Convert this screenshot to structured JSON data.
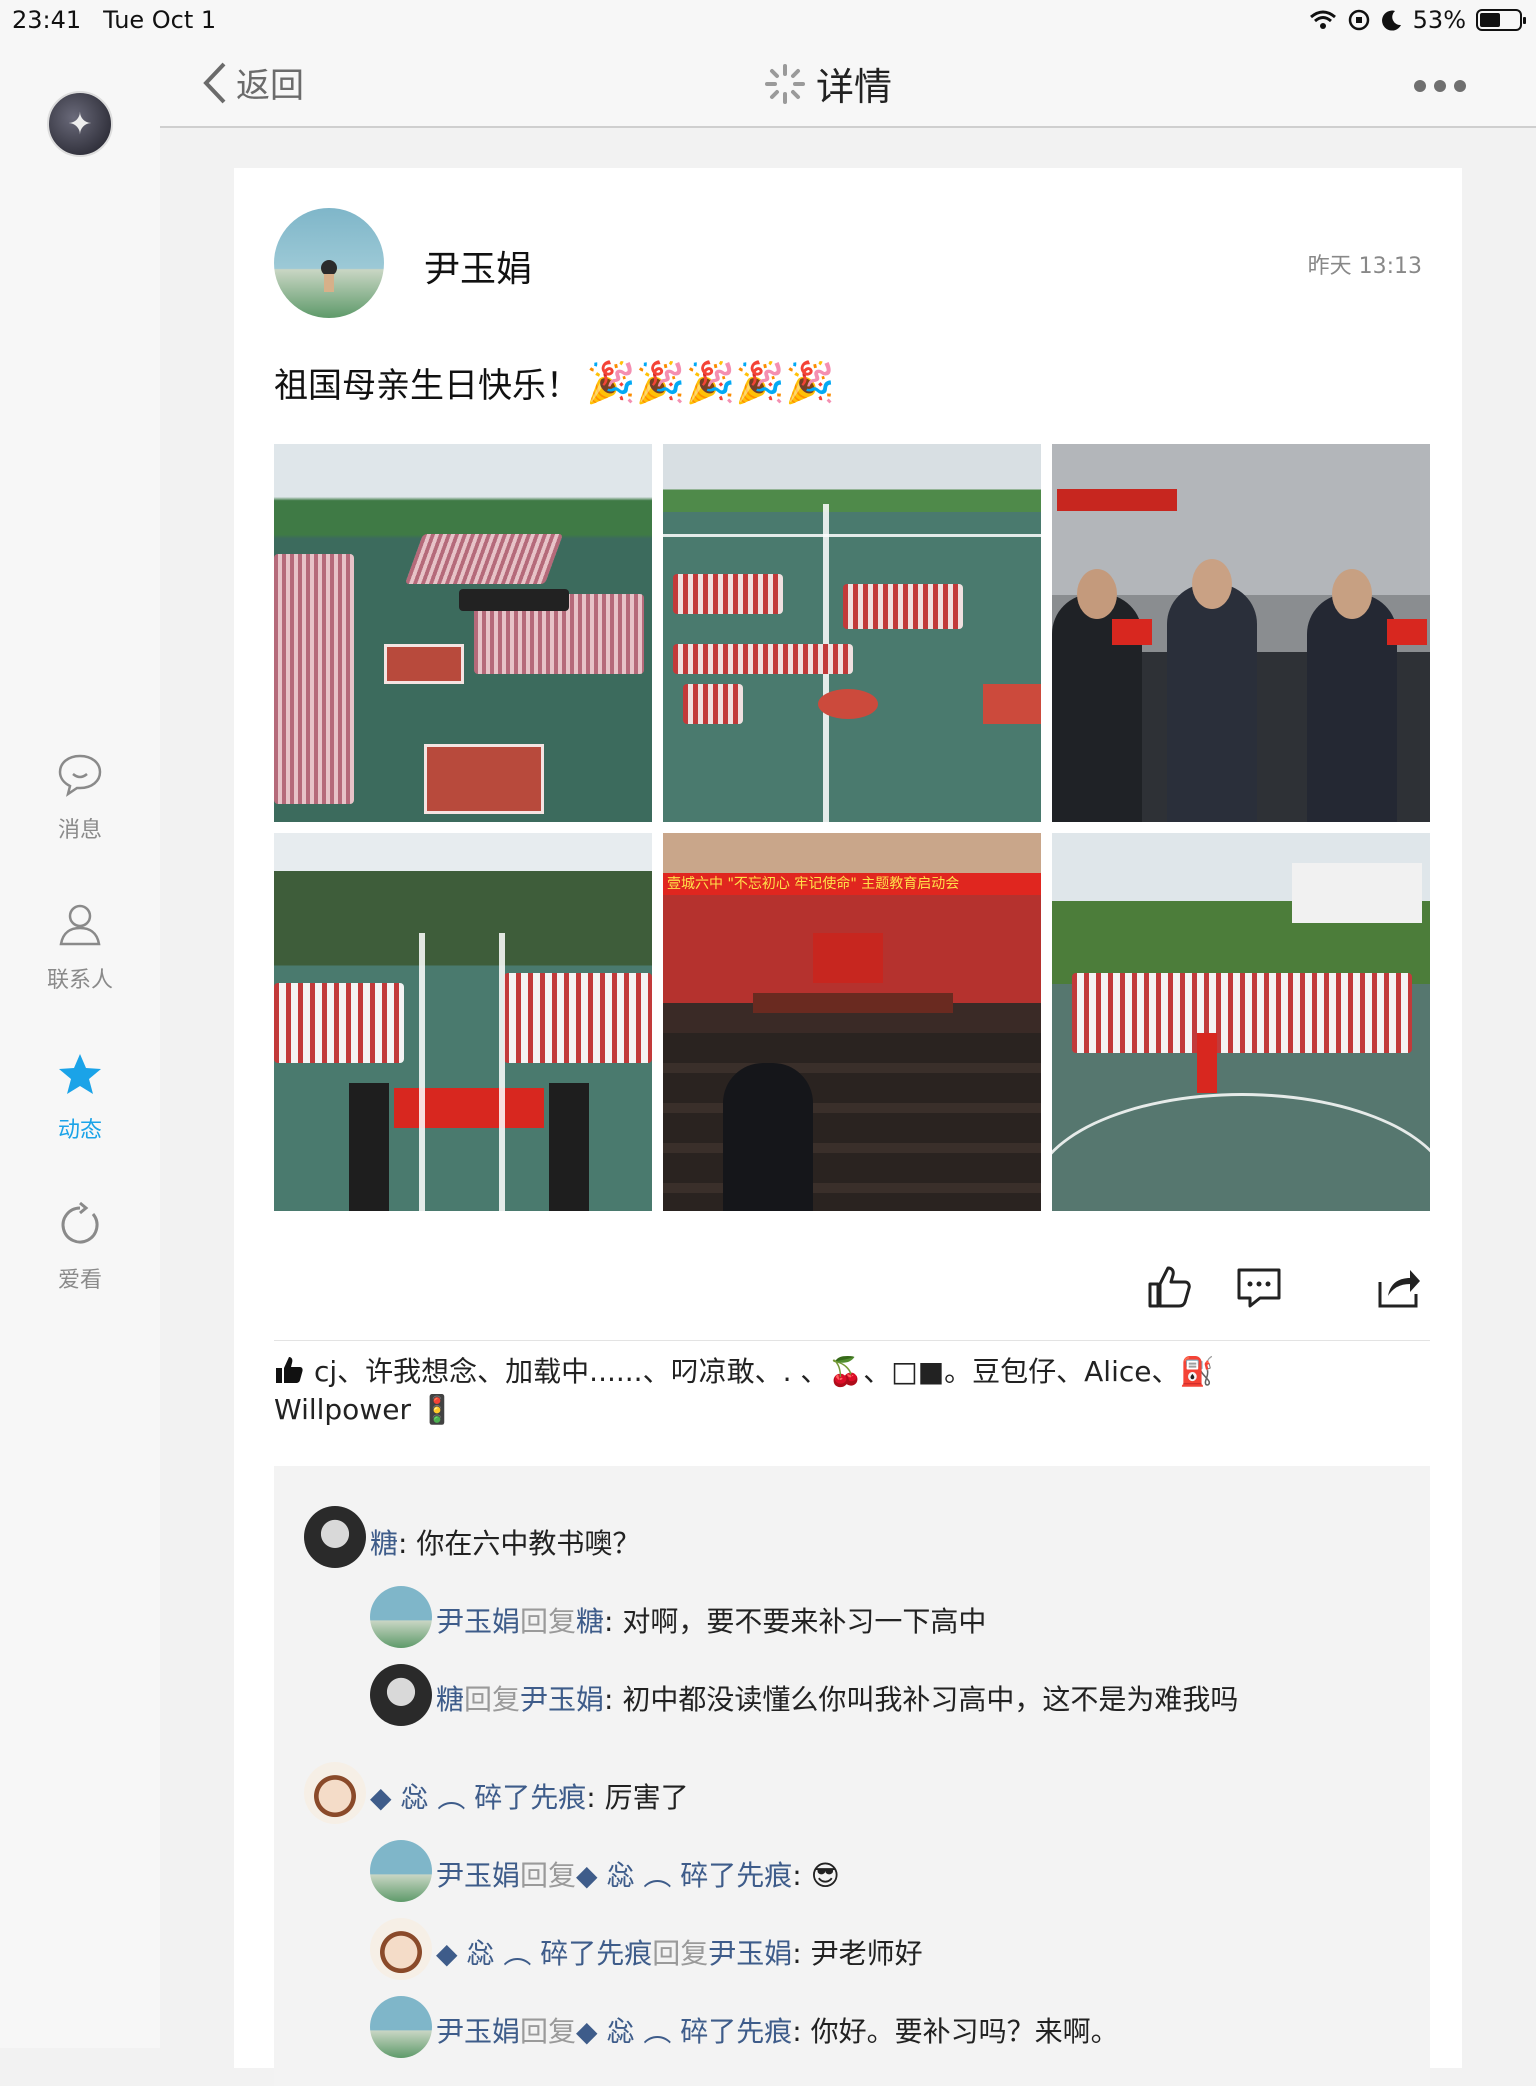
{
  "status": {
    "time": "23:41",
    "date": "Tue Oct 1",
    "battery": "53%",
    "battery_level": 0.53
  },
  "sidebar": {
    "items": [
      {
        "label": "消息",
        "icon": "chat-bubble-icon"
      },
      {
        "label": "联系人",
        "icon": "person-icon"
      },
      {
        "label": "动态",
        "icon": "star-icon",
        "active": true
      },
      {
        "label": "爱看",
        "icon": "refresh-icon"
      }
    ]
  },
  "nav": {
    "back_label": "返回",
    "title": "详情"
  },
  "post": {
    "author": "尹玉娟",
    "time": "昨天 13:13",
    "text": "祖国母亲生日快乐！",
    "party": "🎉🎉🎉🎉🎉"
  },
  "likes": {
    "line1": "cj、许我想念、加载中......、叼凉敢、. 、🍒、□■。豆包仔、Alice、⛽",
    "line2": "Willpower 🚦"
  },
  "comments": [
    {
      "name": "糖",
      "text": ": 你在六中教书噢？"
    },
    {
      "name": "尹玉娟",
      "reply_word": "回复",
      "to": "糖",
      "text": ": 对啊，要不要来补习一下高中"
    },
    {
      "name": "糖",
      "reply_word": "回复",
      "to": "尹玉娟",
      "text": ": 初中都没读懂么你叫我补习高中，这不是为难我吗"
    },
    {
      "name": "◆ 惢 ︵ 碎了先痕",
      "text": ": 厉害了"
    },
    {
      "name": "尹玉娟",
      "reply_word": "回复",
      "to": "◆ 惢 ︵ 碎了先痕",
      "text": ": 😎"
    },
    {
      "name": "◆ 惢 ︵ 碎了先痕",
      "reply_word": "回复",
      "to": "尹玉娟",
      "text": ": 尹老师好"
    },
    {
      "name": "尹玉娟",
      "reply_word": "回复",
      "to": "◆ 惢 ︵ 碎了先痕",
      "text": ": 你好。要补习吗？来啊。"
    }
  ],
  "photo_sign": "壹城六中 \"不忘初心 牢记使命\" 主题教育启动会",
  "colors": {
    "accent": "#1aa3e8",
    "name_link": "#3e5c8a"
  }
}
